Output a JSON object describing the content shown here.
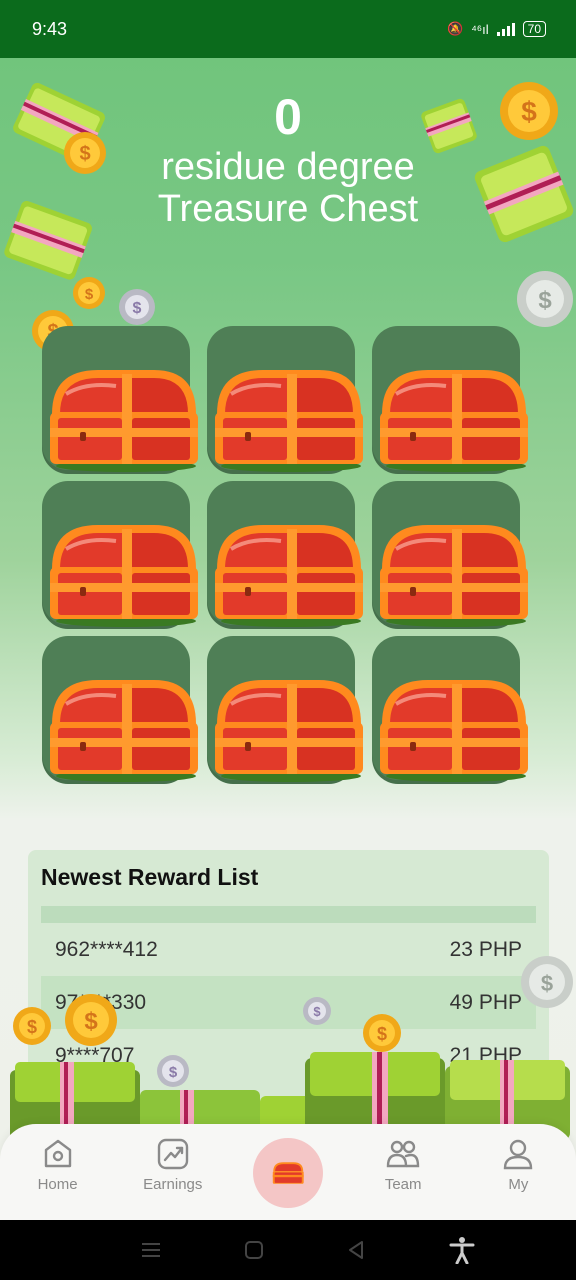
{
  "status_bar": {
    "time": "9:43",
    "network": "⁴⁶ıl",
    "battery": "70"
  },
  "header": {
    "count": "0",
    "line1": "residue degree",
    "line2": "Treasure Chest"
  },
  "chests": [
    {
      "icon": "treasure-chest-icon"
    },
    {
      "icon": "treasure-chest-icon"
    },
    {
      "icon": "treasure-chest-icon"
    },
    {
      "icon": "treasure-chest-icon"
    },
    {
      "icon": "treasure-chest-icon"
    },
    {
      "icon": "treasure-chest-icon"
    },
    {
      "icon": "treasure-chest-icon"
    },
    {
      "icon": "treasure-chest-icon"
    },
    {
      "icon": "treasure-chest-icon"
    }
  ],
  "reward_list": {
    "title": "Newest Reward List",
    "rows": [
      {
        "user": "962****412",
        "amount": "23 PHP"
      },
      {
        "user": "97****330",
        "amount": "49 PHP"
      },
      {
        "user": "9****707",
        "amount": "21 PHP"
      }
    ]
  },
  "tabs": [
    {
      "label": "Home",
      "icon": "home-icon"
    },
    {
      "label": "Earnings",
      "icon": "earnings-chart-icon"
    },
    {
      "label": "",
      "icon": "treasure-chest-icon"
    },
    {
      "label": "Team",
      "icon": "team-icon"
    },
    {
      "label": "My",
      "icon": "user-icon"
    }
  ],
  "colors": {
    "status_bar": "#0b6b1c",
    "chest_tile": "#4f7f56",
    "chest_orange": "#ff8a1e",
    "chest_red": "#e23a2a",
    "accent_pink": "#f4c6c6"
  }
}
